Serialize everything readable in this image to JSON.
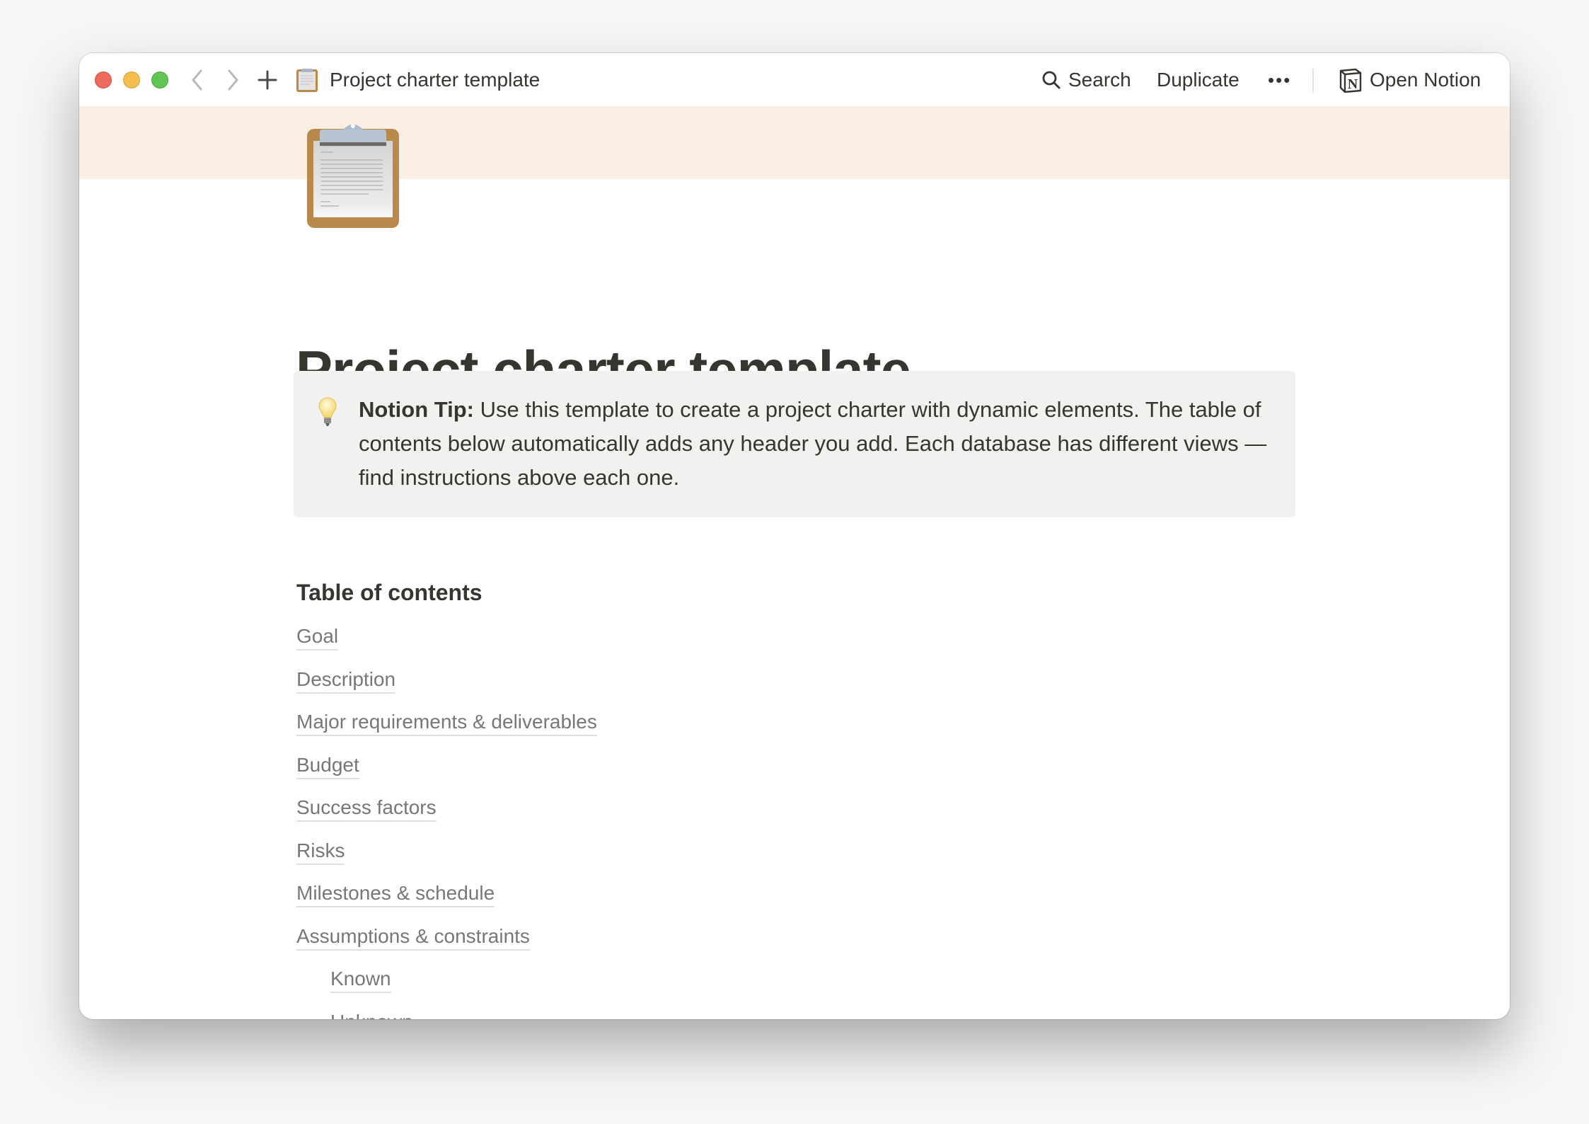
{
  "window": {
    "traffic_lights": [
      "close",
      "minimize",
      "zoom"
    ],
    "nav": {
      "back_icon": "chevron-left-icon",
      "forward_icon": "chevron-right-icon",
      "new_tab_icon": "plus-icon"
    },
    "tab_title": "Project charter template",
    "page_icon": "clipboard-icon"
  },
  "toolbar": {
    "search_label": "Search",
    "duplicate_label": "Duplicate",
    "more_label": "•••",
    "open_notion_label": "Open Notion"
  },
  "colors": {
    "cover": "#fbeee4",
    "text": "#37352f",
    "callout_bg": "#f1f1ef",
    "link": "#787774"
  },
  "page": {
    "title": "Project charter template",
    "callout": {
      "icon": "lightbulb-icon",
      "bold_prefix": "Notion Tip:",
      "text": " Use this template to create a project charter with dynamic elements. The table of contents below automatically adds any header you add. Each database has different views — find instructions above each one."
    },
    "toc": {
      "heading": "Table of contents",
      "items": [
        {
          "label": "Goal",
          "level": 1
        },
        {
          "label": "Description",
          "level": 1
        },
        {
          "label": "Major requirements & deliverables",
          "level": 1
        },
        {
          "label": "Budget",
          "level": 1
        },
        {
          "label": "Success factors",
          "level": 1
        },
        {
          "label": "Risks",
          "level": 1
        },
        {
          "label": "Milestones & schedule",
          "level": 1
        },
        {
          "label": "Assumptions & constraints",
          "level": 1
        },
        {
          "label": "Known",
          "level": 2
        },
        {
          "label": "Unknown",
          "level": 2
        }
      ]
    }
  }
}
